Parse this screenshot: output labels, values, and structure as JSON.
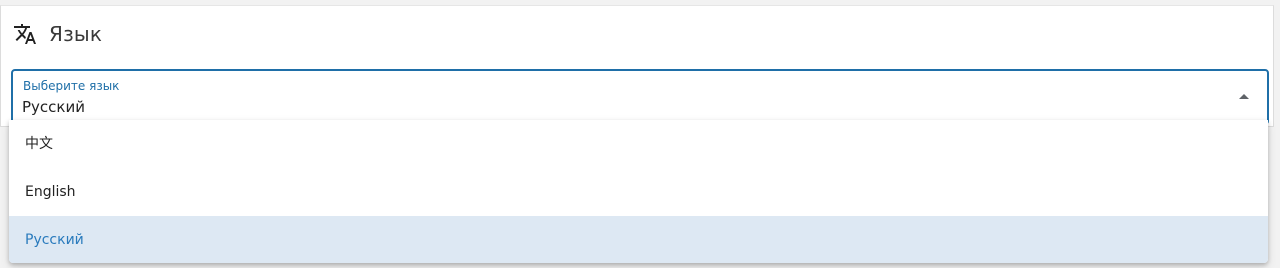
{
  "section": {
    "title": "Язык",
    "icon": "translate-icon"
  },
  "language_select": {
    "label": "Выберите язык",
    "value": "Русский",
    "arrow_icon": "arrow-drop-up-icon",
    "accent_color": "#1f6fa8",
    "options": [
      {
        "label": "中文",
        "selected": false
      },
      {
        "label": "English",
        "selected": false
      },
      {
        "label": "Русский",
        "selected": true
      }
    ]
  }
}
